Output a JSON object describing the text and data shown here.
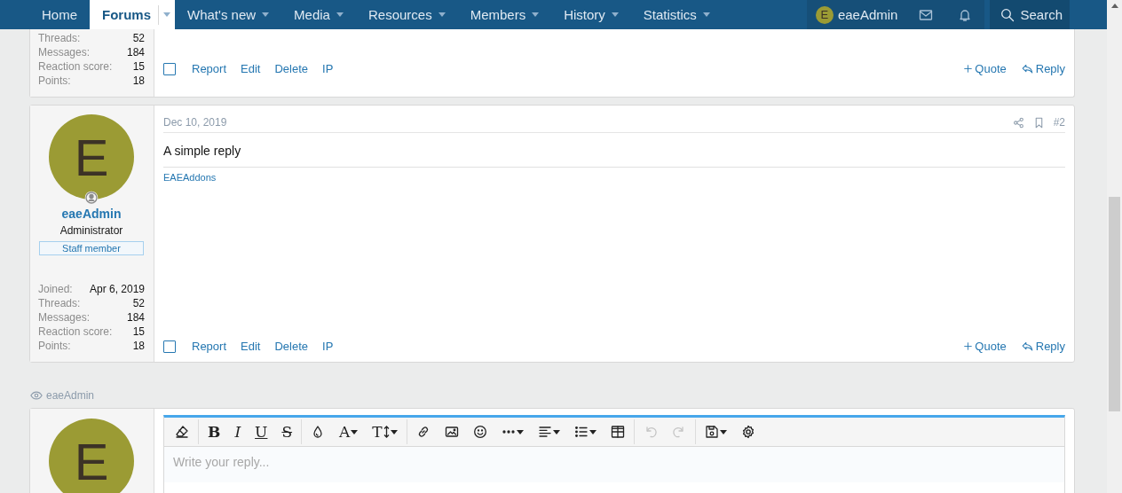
{
  "nav": {
    "items": [
      {
        "label": "Home",
        "selected": false,
        "dropdown": false
      },
      {
        "label": "Forums",
        "selected": true,
        "dropdown": true
      },
      {
        "label": "What's new",
        "selected": false,
        "dropdown": true
      },
      {
        "label": "Media",
        "selected": false,
        "dropdown": true
      },
      {
        "label": "Resources",
        "selected": false,
        "dropdown": true
      },
      {
        "label": "Members",
        "selected": false,
        "dropdown": true
      },
      {
        "label": "History",
        "selected": false,
        "dropdown": true
      },
      {
        "label": "Statistics",
        "selected": false,
        "dropdown": true
      }
    ],
    "user": {
      "initial": "E",
      "name": "eaeAdmin"
    },
    "search": "Search"
  },
  "posts": [
    {
      "cut": true,
      "stats": [
        {
          "label": "Threads:",
          "value": "52"
        },
        {
          "label": "Messages:",
          "value": "184"
        },
        {
          "label": "Reaction score:",
          "value": "15"
        },
        {
          "label": "Points:",
          "value": "18"
        }
      ],
      "actions": [
        "Report",
        "Edit",
        "Delete",
        "IP"
      ],
      "quote": "Quote",
      "reply": "Reply"
    },
    {
      "cut": false,
      "user": {
        "initial": "E",
        "name": "eaeAdmin",
        "title": "Administrator",
        "badge": "Staff member"
      },
      "date": "Dec 10, 2019",
      "number": "#2",
      "body": "A simple reply",
      "signature": "EAEAddons",
      "stats": [
        {
          "label": "Joined:",
          "value": "Apr 6, 2019"
        },
        {
          "label": "Threads:",
          "value": "52"
        },
        {
          "label": "Messages:",
          "value": "184"
        },
        {
          "label": "Reaction score:",
          "value": "15"
        },
        {
          "label": "Points:",
          "value": "18"
        }
      ],
      "actions": [
        "Report",
        "Edit",
        "Delete",
        "IP"
      ],
      "quote": "Quote",
      "reply": "Reply"
    }
  ],
  "viewers": [
    "eaeAdmin"
  ],
  "editor": {
    "avatar_initial": "E",
    "placeholder": "Write your reply...",
    "toolbar": [
      [
        {
          "kind": "clear",
          "disabled": false,
          "dropdown": false
        }
      ],
      [
        {
          "kind": "bold",
          "label": "B",
          "disabled": false,
          "dropdown": false
        },
        {
          "kind": "italic",
          "label": "I",
          "disabled": false,
          "dropdown": false
        },
        {
          "kind": "underline",
          "label": "U",
          "disabled": false,
          "dropdown": false
        },
        {
          "kind": "strike",
          "label": "S",
          "disabled": false,
          "dropdown": false
        }
      ],
      [
        {
          "kind": "color",
          "disabled": false,
          "dropdown": false
        },
        {
          "kind": "font",
          "label": "A",
          "disabled": false,
          "dropdown": true
        },
        {
          "kind": "size",
          "label": "T",
          "disabled": false,
          "dropdown": true
        }
      ],
      [
        {
          "kind": "link",
          "disabled": false,
          "dropdown": false
        },
        {
          "kind": "image",
          "disabled": false,
          "dropdown": false
        },
        {
          "kind": "smilie",
          "disabled": false,
          "dropdown": false
        },
        {
          "kind": "more",
          "disabled": false,
          "dropdown": true
        },
        {
          "kind": "align",
          "disabled": false,
          "dropdown": true
        },
        {
          "kind": "list",
          "disabled": false,
          "dropdown": true
        },
        {
          "kind": "table",
          "disabled": false,
          "dropdown": false
        }
      ],
      [
        {
          "kind": "undo",
          "disabled": true,
          "dropdown": false
        },
        {
          "kind": "redo",
          "disabled": true,
          "dropdown": false
        }
      ],
      [
        {
          "kind": "drafts",
          "disabled": false,
          "dropdown": true
        },
        {
          "kind": "settings",
          "disabled": false,
          "dropdown": false
        }
      ]
    ]
  }
}
